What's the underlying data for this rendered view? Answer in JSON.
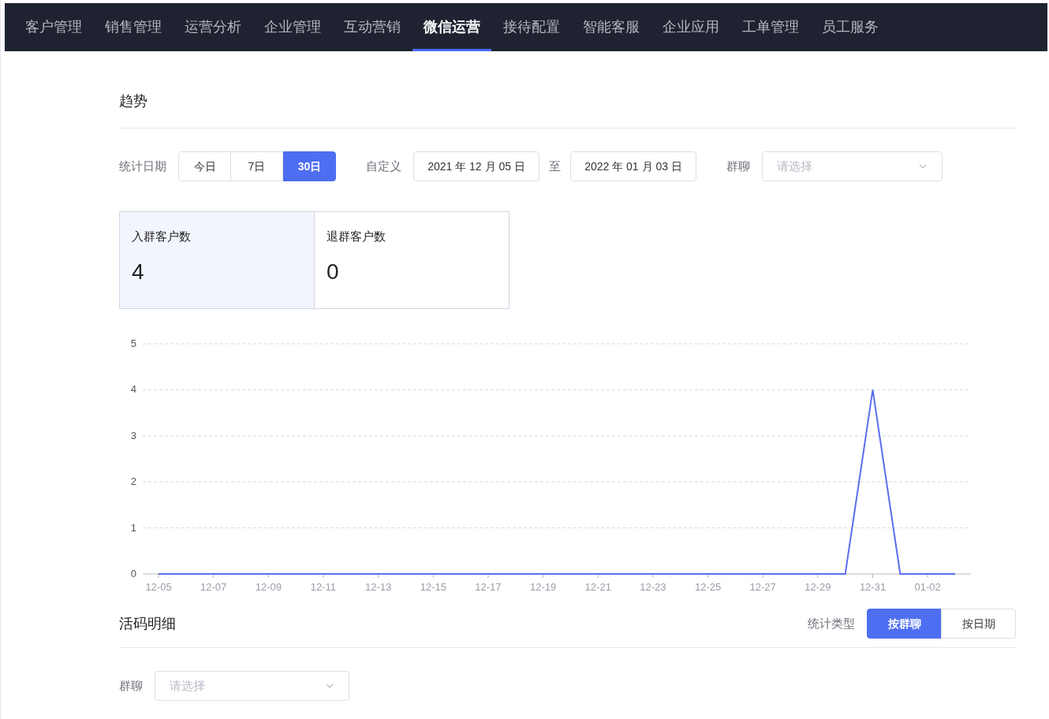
{
  "nav": [
    {
      "label": "客户管理",
      "selected": false
    },
    {
      "label": "销售管理",
      "selected": false
    },
    {
      "label": "运营分析",
      "selected": false
    },
    {
      "label": "企业管理",
      "selected": false
    },
    {
      "label": "互动营销",
      "selected": false
    },
    {
      "label": "微信运营",
      "selected": true
    },
    {
      "label": "接待配置",
      "selected": false
    },
    {
      "label": "智能客服",
      "selected": false
    },
    {
      "label": "企业应用",
      "selected": false
    },
    {
      "label": "工单管理",
      "selected": false
    },
    {
      "label": "员工服务",
      "selected": false
    }
  ],
  "trend": {
    "title": "趋势",
    "date_label": "统计日期",
    "ranges": [
      {
        "label": "今日",
        "selected": false
      },
      {
        "label": "7日",
        "selected": false
      },
      {
        "label": "30日",
        "selected": true
      }
    ],
    "custom_label": "自定义",
    "start_date": "2021 年 12 月 05 日",
    "to_label": "至",
    "end_date": "2022 年 01 月 03 日",
    "group_label": "群聊",
    "group_placeholder": "请选择",
    "stats": [
      {
        "label": "入群客户数",
        "value": "4",
        "selected": true
      },
      {
        "label": "退群客户数",
        "value": "0",
        "selected": false
      }
    ],
    "chart_data": {
      "type": "line",
      "grid": true,
      "categories": [
        "12-05",
        null,
        "12-07",
        null,
        "12-09",
        null,
        "12-11",
        null,
        "12-13",
        null,
        "12-15",
        null,
        "12-17",
        null,
        "12-19",
        null,
        "12-21",
        null,
        "12-23",
        null,
        "12-25",
        null,
        "12-27",
        null,
        "12-29",
        null,
        "12-31",
        null,
        "01-02",
        null
      ],
      "series": [
        {
          "color": "#5b6ff0",
          "values": [
            0,
            0,
            0,
            0,
            0,
            0,
            0,
            0,
            0,
            0,
            0,
            0,
            0,
            0,
            0,
            0,
            0,
            0,
            0,
            0,
            0,
            0,
            0,
            0,
            0,
            0,
            4,
            0,
            0,
            0
          ]
        }
      ],
      "ylim": [
        0,
        5
      ],
      "yticks": [
        0,
        1,
        2,
        3,
        4,
        5
      ]
    }
  },
  "detail": {
    "title": "活码明细",
    "type_label": "统计类型",
    "types": [
      {
        "label": "按群聊",
        "selected": true
      },
      {
        "label": "按日期",
        "selected": false
      }
    ],
    "group_label": "群聊",
    "group_placeholder": "请选择"
  }
}
